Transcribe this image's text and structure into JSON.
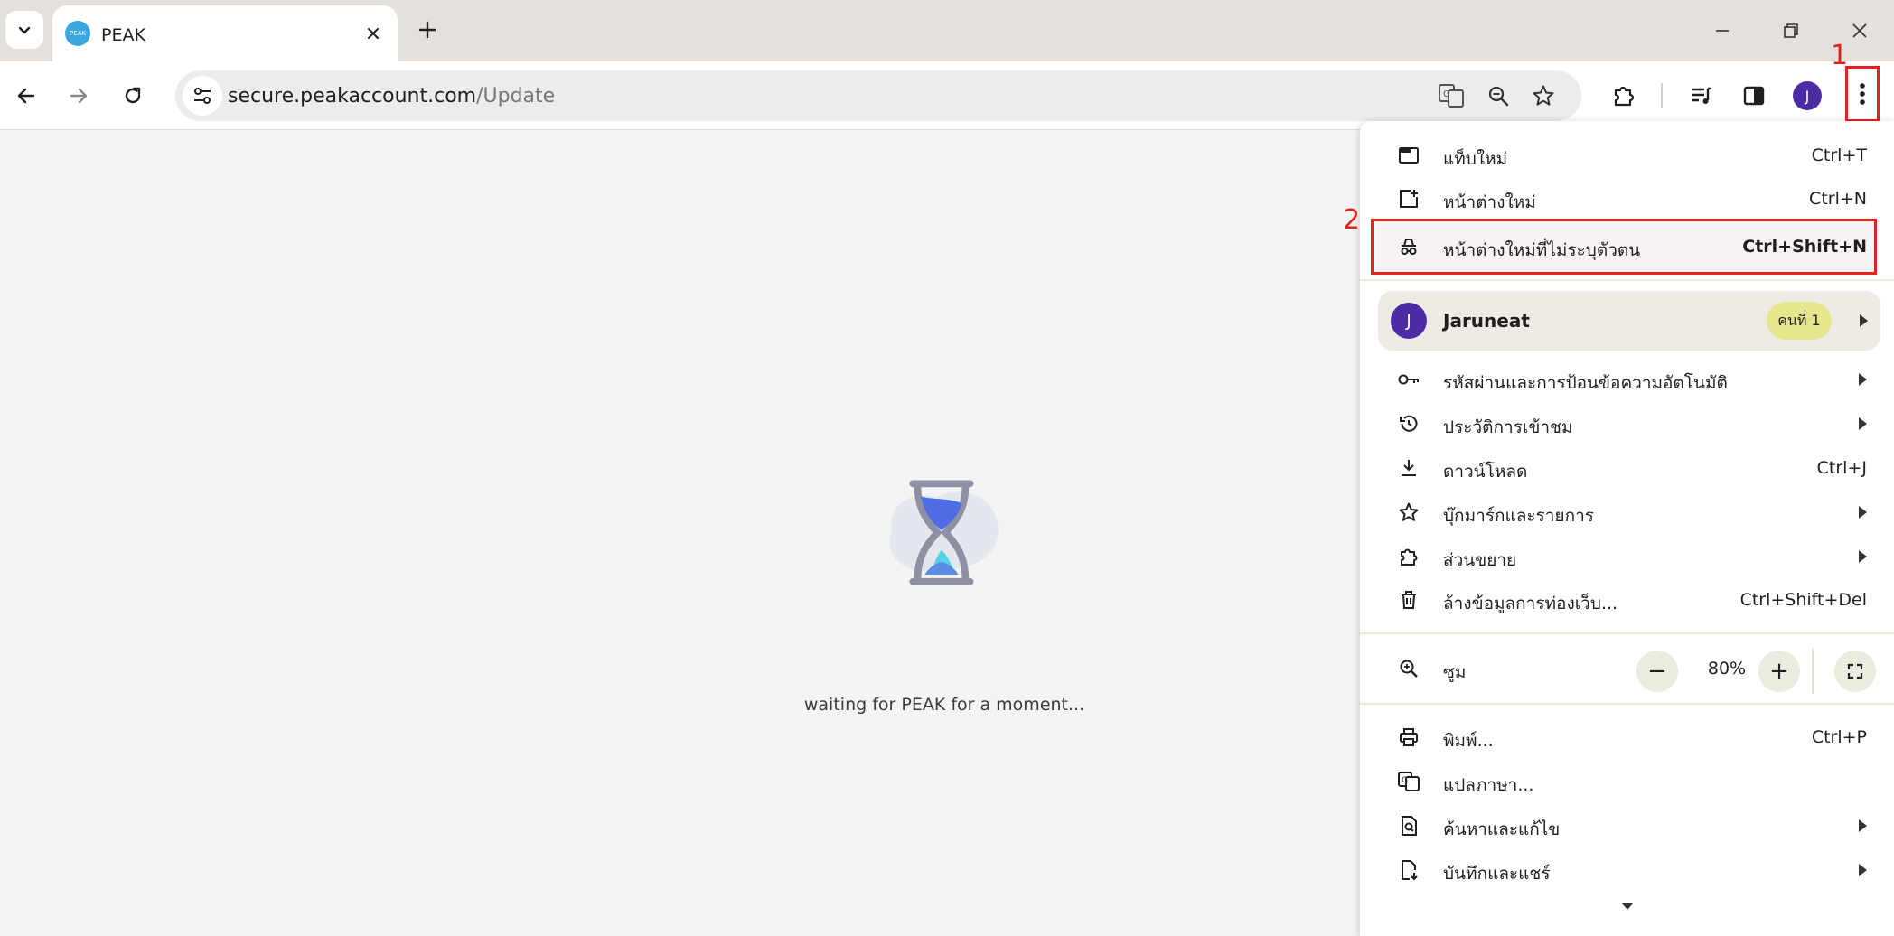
{
  "tab": {
    "title": "PEAK",
    "favicon_text": "PEAK"
  },
  "toolbar": {
    "url_host": "secure.peakaccount.com",
    "url_path": "/Update",
    "avatar_letter": "J"
  },
  "annotations": {
    "step1": "1",
    "step2": "2"
  },
  "page": {
    "loading_text": "waiting for PEAK for a moment..."
  },
  "menu": {
    "new_tab": {
      "label": "แท็บใหม่",
      "shortcut": "Ctrl+T"
    },
    "new_window": {
      "label": "หน้าต่างใหม่",
      "shortcut": "Ctrl+N"
    },
    "incognito": {
      "label": "หน้าต่างใหม่ที่ไม่ระบุตัวตน",
      "shortcut": "Ctrl+Shift+N"
    },
    "profile": {
      "avatar_letter": "J",
      "name": "Jaruneat",
      "badge": "คนที่ 1"
    },
    "passwords": {
      "label": "รหัสผ่านและการป้อนข้อความอัตโนมัติ"
    },
    "history": {
      "label": "ประวัติการเข้าชม"
    },
    "downloads": {
      "label": "ดาวน์โหลด",
      "shortcut": "Ctrl+J"
    },
    "bookmarks": {
      "label": "บุ๊กมาร์กและรายการ"
    },
    "extensions": {
      "label": "ส่วนขยาย"
    },
    "clear_data": {
      "label": "ล้างข้อมูลการท่องเว็บ...",
      "shortcut": "Ctrl+Shift+Del"
    },
    "zoom": {
      "label": "ซูม",
      "minus": "−",
      "value": "80%",
      "plus": "+"
    },
    "print": {
      "label": "พิมพ์...",
      "shortcut": "Ctrl+P"
    },
    "translate": {
      "label": "แปลภาษา..."
    },
    "find_edit": {
      "label": "ค้นหาและแก้ไข"
    },
    "save_share": {
      "label": "บันทึกและแชร์"
    }
  },
  "colors": {
    "annotation_red": "#e2231a",
    "avatar_purple": "#4b2ca4",
    "badge_yellow": "#e6e68c"
  }
}
